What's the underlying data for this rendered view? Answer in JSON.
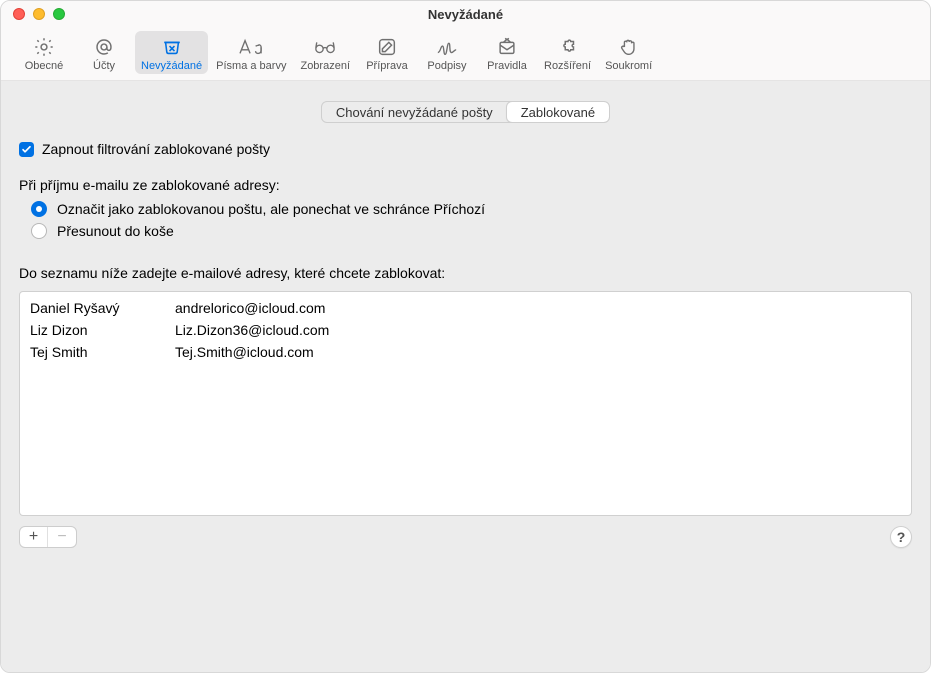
{
  "window": {
    "title": "Nevyžádané"
  },
  "toolbar": {
    "general": {
      "label": "Obecné"
    },
    "accounts": {
      "label": "Účty"
    },
    "junk": {
      "label": "Nevyžádané"
    },
    "fonts": {
      "label": "Písma a barvy"
    },
    "viewing": {
      "label": "Zobrazení"
    },
    "composing": {
      "label": "Příprava"
    },
    "signatures": {
      "label": "Podpisy"
    },
    "rules": {
      "label": "Pravidla"
    },
    "extensions": {
      "label": "Rozšíření"
    },
    "privacy": {
      "label": "Soukromí"
    }
  },
  "tabs": {
    "behavior": "Chování nevyžádané pošty",
    "blocked": "Zablokované"
  },
  "enable_label": "Zapnout filtrování zablokované pošty",
  "when_label": "Při příjmu e-mailu ze zablokované adresy:",
  "radio_mark": "Označit jako zablokovanou poštu, ale ponechat ve schránce Příchozí",
  "radio_trash": "Přesunout do koše",
  "list_label": "Do seznamu níže zadejte e-mailové adresy, které chcete zablokovat:",
  "blocked_list": [
    {
      "name": "Daniel Ryšavý",
      "email": "andrelorico@icloud.com"
    },
    {
      "name": "Liz Dizon",
      "email": "Liz.Dizon36@icloud.com"
    },
    {
      "name": "Tej Smith",
      "email": "Tej.Smith@icloud.com"
    }
  ],
  "buttons": {
    "add": "+",
    "remove": "−",
    "help": "?"
  }
}
